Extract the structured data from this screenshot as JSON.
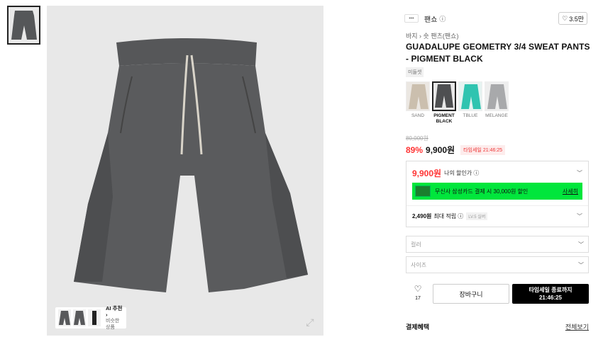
{
  "brand": {
    "logo_text": "▪▪▪▪",
    "name": "팬쇼",
    "likes": "3.5만"
  },
  "breadcrumb": "바지 › 숏 팬츠(팬쇼)",
  "product": {
    "title": "GUADALUPE GEOMETRY 3/4 SWEAT PANTS - PIGMENT BLACK",
    "tag": "미들셋"
  },
  "colors": [
    {
      "label": "SAND",
      "hex": "#cbbfae"
    },
    {
      "label": "PIGMENT BLACK",
      "hex": "#4e4f51"
    },
    {
      "label": "TBLUE",
      "hex": "#2fc4b0"
    },
    {
      "label": "MELANGE",
      "hex": "#a8a9ab"
    }
  ],
  "pricing": {
    "original": "80,000원",
    "discount": "89%",
    "sale": "9,900원",
    "timer_badge": "타임세일 21:46:25"
  },
  "benefits": {
    "my_price": "9,900원",
    "my_price_label": "나의 할인가 ⓘ",
    "card_banner": "무신사 삼성카드 결제 시 30,000원 할인",
    "card_link": "사세히",
    "points_value": "2,490원",
    "points_label": "최대 적립 ⓘ",
    "level_badge": "LV.5 실버"
  },
  "selects": {
    "color_placeholder": "컬러",
    "size_placeholder": "사이즈"
  },
  "actions": {
    "like_count": "17",
    "cart_label": "장바구니",
    "buy_line1": "타임세일 종료까지",
    "buy_line2": "21:46:25"
  },
  "payment": {
    "label": "결제혜택",
    "more": "전체보기"
  },
  "gallery": {
    "reco_title": "AI 추천 ›",
    "reco_sub": "비슷한 상품",
    "product_color": "#58595b"
  },
  "icons": [
    "info-icon",
    "heart-icon",
    "chevron-down-icon",
    "zoom-icon"
  ]
}
